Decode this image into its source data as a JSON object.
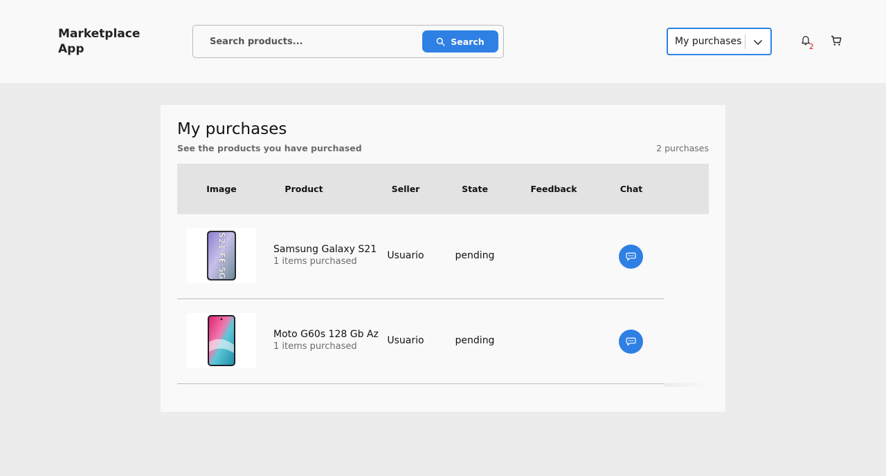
{
  "header": {
    "logo": "Marketplace App",
    "search": {
      "placeholder": "Search products...",
      "value": "",
      "button_label": "Search"
    },
    "menu_select": {
      "selected": "My purchases"
    },
    "notifications": {
      "count": "2"
    },
    "icons": {
      "search": "search-icon",
      "chevron": "chevron-down-icon",
      "bell": "bell-icon",
      "cart": "cart-icon",
      "chat": "chat-icon"
    }
  },
  "page": {
    "title": "My purchases",
    "subtitle": "See the products you have purchased",
    "count_label": "2 purchases"
  },
  "table": {
    "columns": [
      "Image",
      "Product",
      "Seller",
      "State",
      "Feedback",
      "Chat"
    ],
    "rows": [
      {
        "product": "Samsung Galaxy S21",
        "quantity": "1 items purchased",
        "seller": "Usuario",
        "state": "pending",
        "feedback": "",
        "image_text": "S21 FE 5G"
      },
      {
        "product": "Moto G60s 128 Gb Az",
        "quantity": "1 items purchased",
        "seller": "Usuario",
        "state": "pending",
        "feedback": ""
      }
    ]
  },
  "colors": {
    "accent": "#2f80e4",
    "badge": "#dd1111",
    "header_bg": "#f9f9f9",
    "page_bg": "#ececec",
    "table_head_bg": "#e3e3e3"
  }
}
